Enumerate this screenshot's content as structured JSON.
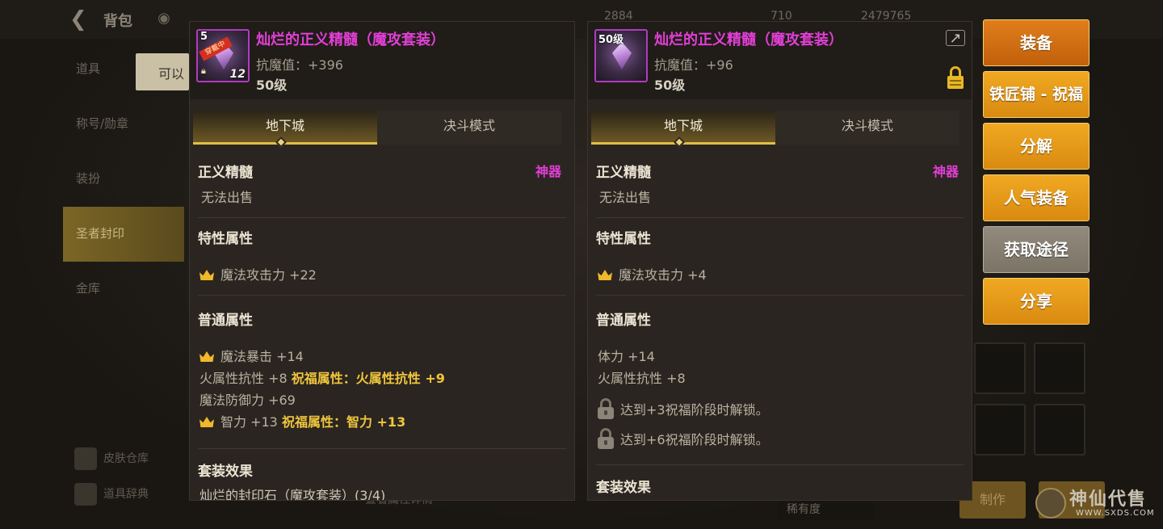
{
  "background": {
    "title": "背包",
    "tooltip": "可以",
    "resources": [
      "2884",
      "710",
      "2479765"
    ],
    "sidebar": [
      "道具",
      "称号/勋章",
      "装扮",
      "圣者封印",
      "金库"
    ],
    "sidebar_active_index": 3,
    "lower_links": [
      "皮肤仓库",
      "道具辞典"
    ],
    "bottom_center": "查看属性详情",
    "sort_label": "稀有度",
    "craft_label": "制作"
  },
  "watermark": {
    "main": "神仙代售",
    "sub": "WWW.SXDS.COM"
  },
  "left_panel": {
    "item_name": "灿烂的正义精髓（魔攻套装）",
    "stat": "抗魔值：+396",
    "level": "50级",
    "icon_level": "5",
    "icon_count": "12",
    "icon_badge": "穿戴中",
    "tabs": [
      "地下城",
      "决斗模式"
    ],
    "category": "正义精髓",
    "grade": "神器",
    "trade": "无法出售",
    "trait_title": "特性属性",
    "trait_line": "魔法攻击力 +22",
    "common_title": "普通属性",
    "common_lines": [
      {
        "crown": true,
        "text": "魔法暴击 +14",
        "bless": ""
      },
      {
        "crown": false,
        "text": "火属性抗性 +8",
        "bless": "祝福属性：火属性抗性 +9"
      },
      {
        "crown": false,
        "text": "魔法防御力 +69",
        "bless": ""
      },
      {
        "crown": true,
        "text": "智力 +13",
        "bless": "祝福属性：智力 +13"
      }
    ],
    "set_title": "套装效果",
    "set_line": "灿烂的封印石（魔攻套装）(3/4)"
  },
  "right_panel": {
    "item_name": "灿烂的正义精髓（魔攻套装）",
    "stat": "抗魔值：+96",
    "level": "50级",
    "icon_level": "50级",
    "tabs": [
      "地下城",
      "决斗模式"
    ],
    "category": "正义精髓",
    "grade": "神器",
    "trade": "无法出售",
    "trait_title": "特性属性",
    "trait_line": "魔法攻击力 +4",
    "common_title": "普通属性",
    "common_lines": [
      "体力 +14",
      "火属性抗性 +8"
    ],
    "locked_lines": [
      "达到+3祝福阶段时解锁。",
      "达到+6祝福阶段时解锁。"
    ],
    "set_title": "套装效果"
  },
  "actions": [
    "装备",
    "铁匠铺 - 祝福",
    "分解",
    "人气装备",
    "获取途径",
    "分享"
  ],
  "colors": {
    "item_name": "#e23fd6",
    "gold_text": "#f1c63d",
    "button_orange": "#e59a18",
    "button_grey": "#8a8274"
  }
}
